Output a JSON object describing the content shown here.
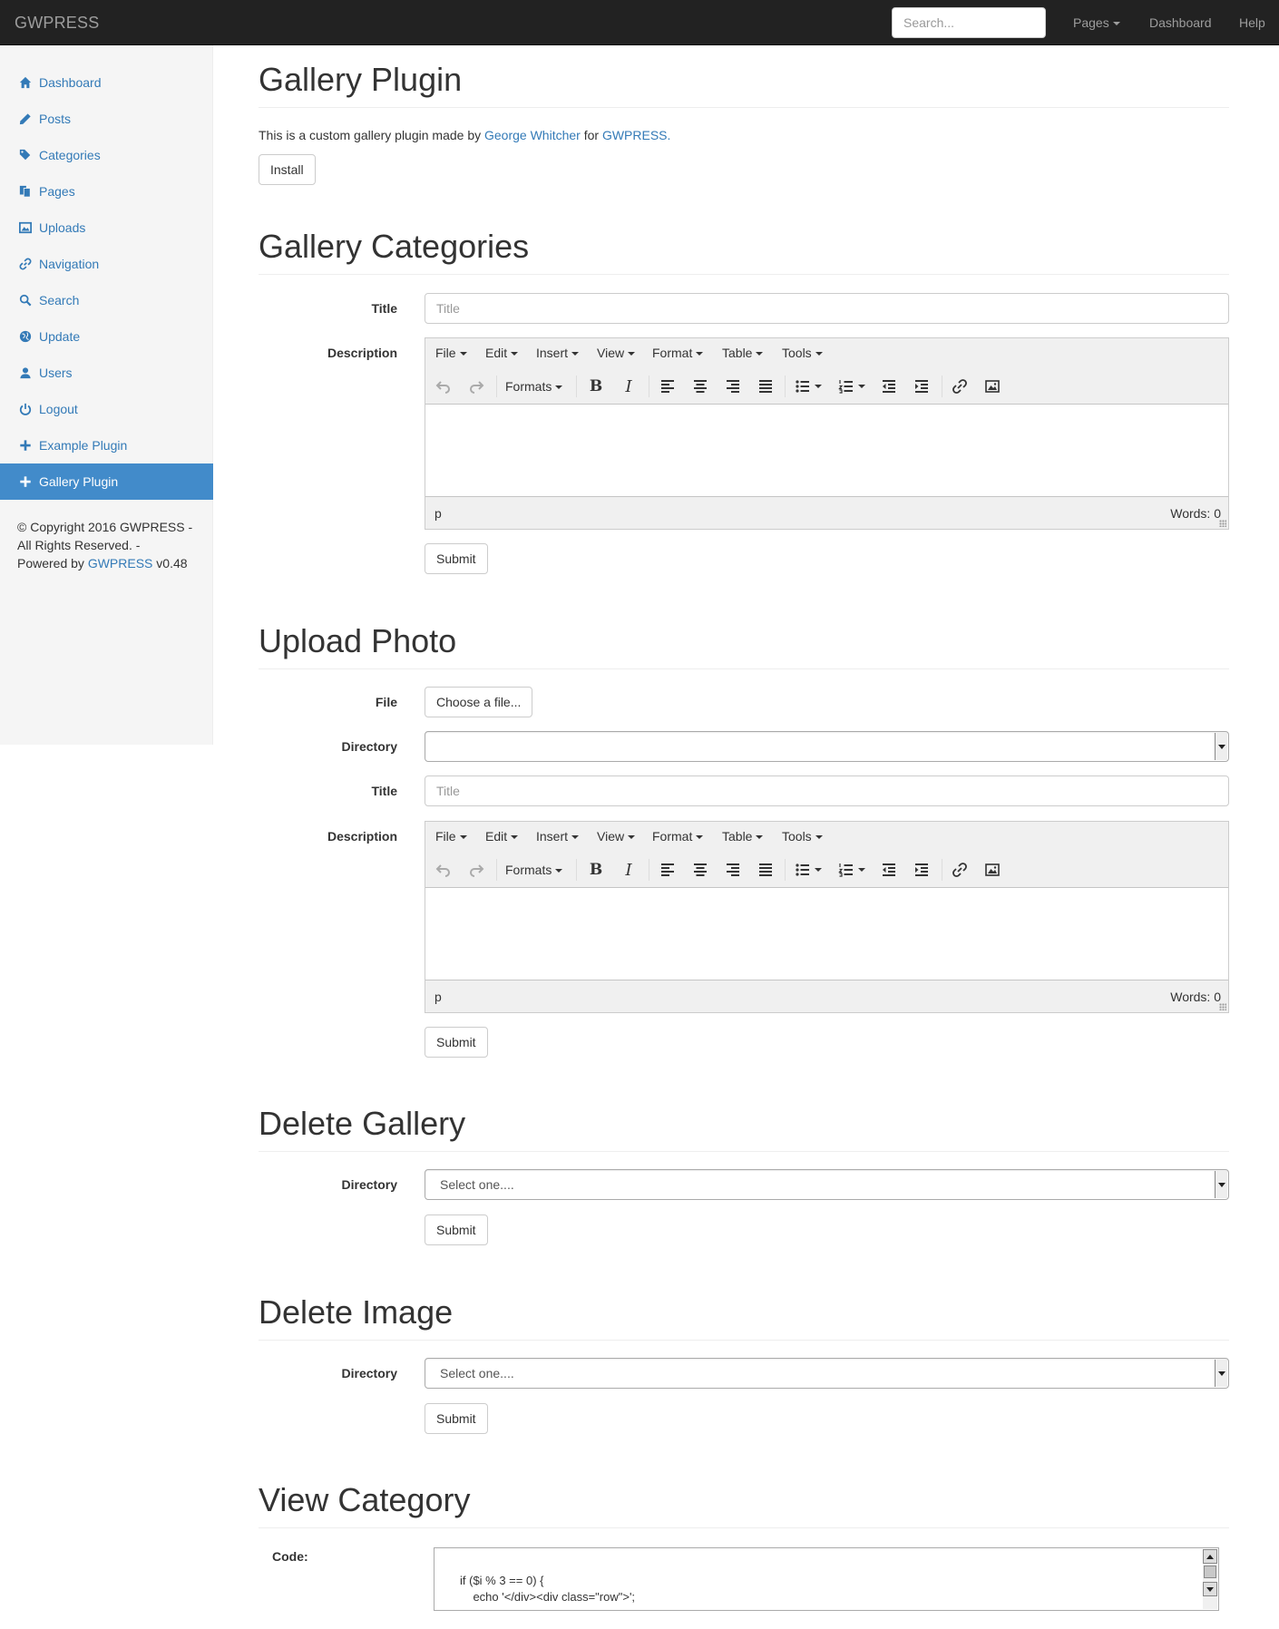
{
  "navbar": {
    "brand": "GWPRESS",
    "search_placeholder": "Search...",
    "pages_label": "Pages",
    "dashboard_label": "Dashboard",
    "help_label": "Help"
  },
  "sidebar": {
    "items": [
      {
        "label": "Dashboard",
        "icon": "home-icon"
      },
      {
        "label": "Posts",
        "icon": "pencil-icon"
      },
      {
        "label": "Categories",
        "icon": "tags-icon"
      },
      {
        "label": "Pages",
        "icon": "pages-icon"
      },
      {
        "label": "Uploads",
        "icon": "picture-icon"
      },
      {
        "label": "Navigation",
        "icon": "link-icon"
      },
      {
        "label": "Search",
        "icon": "search-icon"
      },
      {
        "label": "Update",
        "icon": "globe-icon"
      },
      {
        "label": "Users",
        "icon": "user-icon"
      },
      {
        "label": "Logout",
        "icon": "power-icon"
      },
      {
        "label": "Example Plugin",
        "icon": "plus-icon"
      },
      {
        "label": "Gallery Plugin",
        "icon": "plus-icon",
        "active": true
      }
    ],
    "copyright": {
      "line1": "© Copyright 2016 GWPRESS -",
      "line2": "All Rights Reserved. -",
      "powered_by": "Powered by",
      "powered_link": "GWPRESS",
      "version": "v0.48"
    }
  },
  "plugin": {
    "title": "Gallery Plugin",
    "intro_prefix": "This is a custom gallery plugin made by",
    "author": "George Whitcher",
    "intro_for": "for",
    "site": "GWPRESS.",
    "install_label": "Install"
  },
  "editor": {
    "menus": [
      "File",
      "Edit",
      "Insert",
      "View",
      "Format",
      "Table",
      "Tools"
    ],
    "formats_label": "Formats",
    "path": "p",
    "words": "Words: 0"
  },
  "categories": {
    "title": "Gallery Categories",
    "title_label": "Title",
    "title_placeholder": "Title",
    "description_label": "Description",
    "submit_label": "Submit"
  },
  "upload": {
    "title": "Upload Photo",
    "file_label": "File",
    "choose_label": "Choose a file...",
    "directory_label": "Directory",
    "directory_value": "",
    "title_label": "Title",
    "title_placeholder": "Title",
    "description_label": "Description",
    "submit_label": "Submit"
  },
  "delete_gallery": {
    "title": "Delete Gallery",
    "directory_label": "Directory",
    "select_value": "Select one....",
    "submit_label": "Submit"
  },
  "delete_image": {
    "title": "Delete Image",
    "directory_label": "Directory",
    "select_value": "Select one....",
    "submit_label": "Submit"
  },
  "view_category": {
    "title": "View Category",
    "code_label": "Code:",
    "code_line1": "if ($i % 3 == 0) {",
    "code_line2": "    echo '</div><div class=\"row\">';"
  },
  "colors": {
    "navbar_bg": "#222222",
    "link": "#337ab7",
    "active_bg": "#428bca"
  }
}
